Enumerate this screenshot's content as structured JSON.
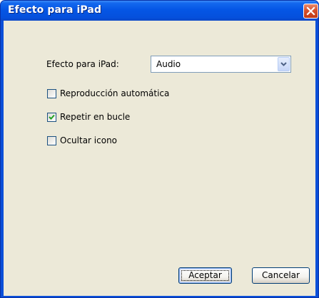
{
  "window": {
    "title": "Efecto para iPad"
  },
  "form": {
    "effect_label": "Efecto para iPad:",
    "effect_select": {
      "selected": "Audio"
    },
    "options": [
      {
        "label": "Reproducción automática",
        "checked": false
      },
      {
        "label": "Repetir en bucle",
        "checked": true
      },
      {
        "label": "Ocultar icono",
        "checked": false
      }
    ]
  },
  "buttons": {
    "ok_label": "Aceptar",
    "cancel_label": "Cancelar"
  },
  "icons": {
    "close": "close-icon",
    "dropdown": "chevron-down-icon",
    "check": "checkmark-icon"
  },
  "colors": {
    "titlebar": "#0556e5",
    "close_button": "#d6502c",
    "client_background": "#ece9d8",
    "checkmark": "#21a121"
  }
}
